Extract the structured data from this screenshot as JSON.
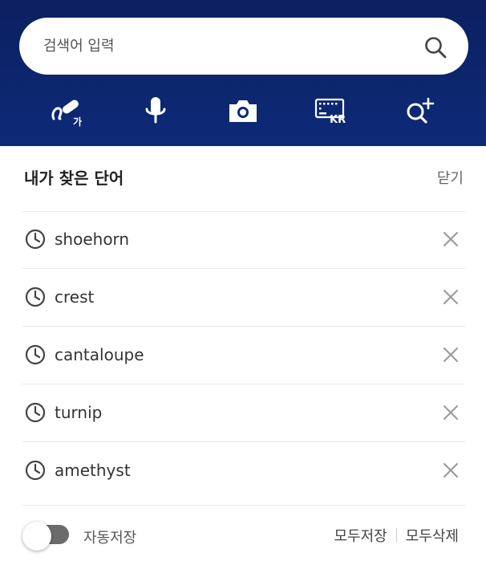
{
  "search": {
    "placeholder": "검색어 입력",
    "icon": "search-icon"
  },
  "toolbar": {
    "tools": [
      {
        "name": "handwriting",
        "icon": "handwriting-icon",
        "badge": "가"
      },
      {
        "name": "voice",
        "icon": "microphone-icon"
      },
      {
        "name": "camera",
        "icon": "camera-icon"
      },
      {
        "name": "keyboard",
        "icon": "keyboard-icon",
        "badge": "KR"
      },
      {
        "name": "add-search",
        "icon": "search-plus-icon"
      }
    ]
  },
  "history": {
    "title": "내가 찾은 단어",
    "close_label": "닫기",
    "items": [
      {
        "word": "shoehorn"
      },
      {
        "word": "crest"
      },
      {
        "word": "cantaloupe"
      },
      {
        "word": "turnip"
      },
      {
        "word": "amethyst"
      }
    ]
  },
  "footer": {
    "auto_save_label": "자동저장",
    "auto_save_on": false,
    "save_all_label": "모두저장",
    "delete_all_label": "모두삭제"
  },
  "colors": {
    "header_bg": "#0d2a78",
    "text": "#333333",
    "muted": "#666666"
  }
}
